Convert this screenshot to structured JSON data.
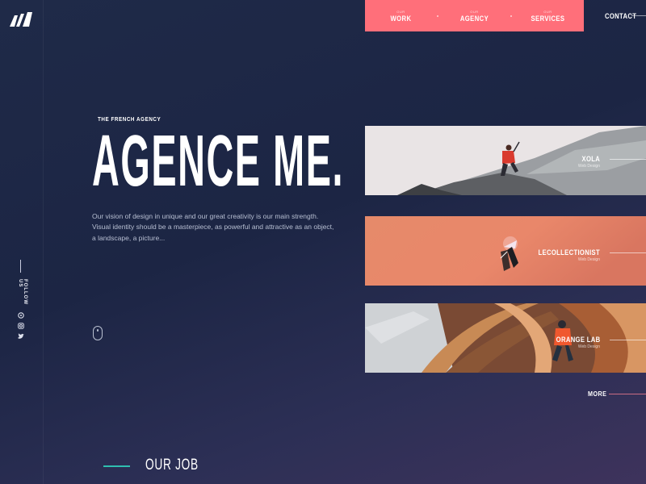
{
  "nav": {
    "items": [
      {
        "small": "OUR",
        "label": "WORK"
      },
      {
        "small": "OUR",
        "label": "AGENCY"
      },
      {
        "small": "OUR",
        "label": "SERVICES"
      }
    ],
    "contact": "CONTACT"
  },
  "hero": {
    "eyebrow": "THE FRENCH AGENCY",
    "title": "AGENCE ME.",
    "description": "Our vision of design in unique and our great creativity is our main strength. Visual identity should be a masterpiece, as powerful and attractive as an object, a landscape, a picture..."
  },
  "follow": {
    "label": "FOLLOW US"
  },
  "projects": [
    {
      "name": "XOLA",
      "sub": "Web Design"
    },
    {
      "name": "LECOLLECTIONIST",
      "sub": "Web Design"
    },
    {
      "name": "ORANGE LAB",
      "sub": "Web Design"
    }
  ],
  "more": "MORE",
  "section": {
    "title": "OUR JOB"
  },
  "colors": {
    "accent": "#ff6f7a",
    "teal": "#2fbfb0",
    "background": "#1f2a48"
  }
}
